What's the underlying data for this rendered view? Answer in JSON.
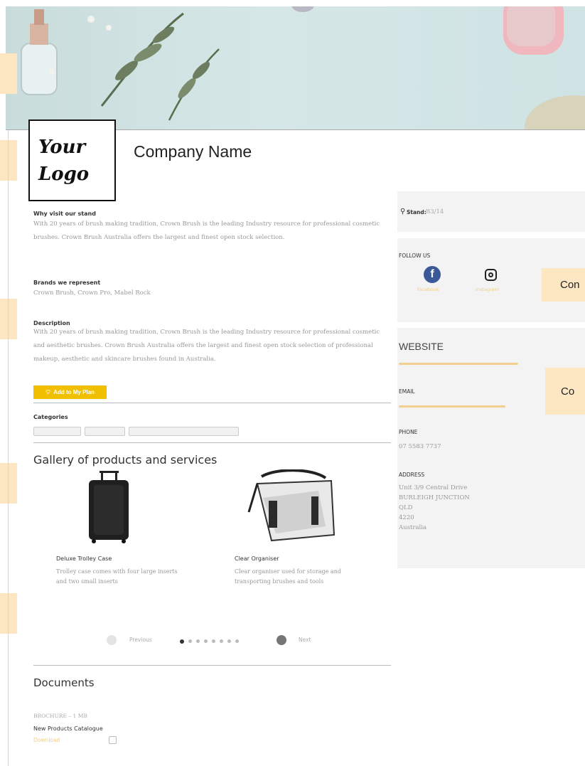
{
  "header": {
    "logo_line1": "Your",
    "logo_line2": "Logo",
    "company_name": "Company Name"
  },
  "about": {
    "why_visit_heading": "Why visit our stand",
    "why_visit_text": "With 20 years of brush making tradition, Crown Brush is the leading Industry resource for professional cosmetic brushes. Crown Brush Australia offers the largest and finest open stock selection.",
    "brands_heading": "Brands we represent",
    "brands_text": "Crown Brush, Crown Pro, Mabel Rock",
    "description_heading": "Description",
    "description_text": "With 20 years of brush making tradition, Crown Brush is the leading Industry resource for professional cosmetic and aesthetic brushes. Crown Brush Australia offers the largest and finest open stock selection of professional makeup, aesthetic and skincare brushes found in Australia.",
    "add_favourites_label": "Add to My Plan",
    "categories_heading": "Categories"
  },
  "gallery": {
    "title": "Gallery of products and services",
    "items": [
      {
        "name": "Deluxe Trolley Case",
        "description": "Trolley case comes with four large inserts and two small inserts"
      },
      {
        "name": "Clear Organiser",
        "description": "Clear organiser used for storage and transporting brushes and tools"
      }
    ],
    "prev_label": "Previous",
    "next_label": "Next"
  },
  "documents": {
    "title": "Documents",
    "meta": "BROCHURE – 1 MB",
    "doc_name": "New Products Catalogue",
    "download_label": "Download"
  },
  "sidebar": {
    "stand_label": "Stand:",
    "stand_value": "B3/14",
    "follow_heading": "FOLLOW US",
    "facebook_label": "Facebook",
    "instagram_label": "Instagram",
    "website_heading": "WEBSITE",
    "email_heading": "EMAIL",
    "phone_heading": "PHONE",
    "phone_value": "07 5583 7737",
    "address_heading": "ADDRESS",
    "address_lines": [
      "Unit 3/9 Central Drive",
      "BURLEIGH JUNCTION",
      "QLD",
      "4220",
      "Australia"
    ],
    "overlay_label_1": "Con",
    "overlay_label_2": "Co"
  },
  "colors": {
    "accent": "#f0c000",
    "facebook": "#3b5998",
    "peach": "#fde7c3"
  }
}
